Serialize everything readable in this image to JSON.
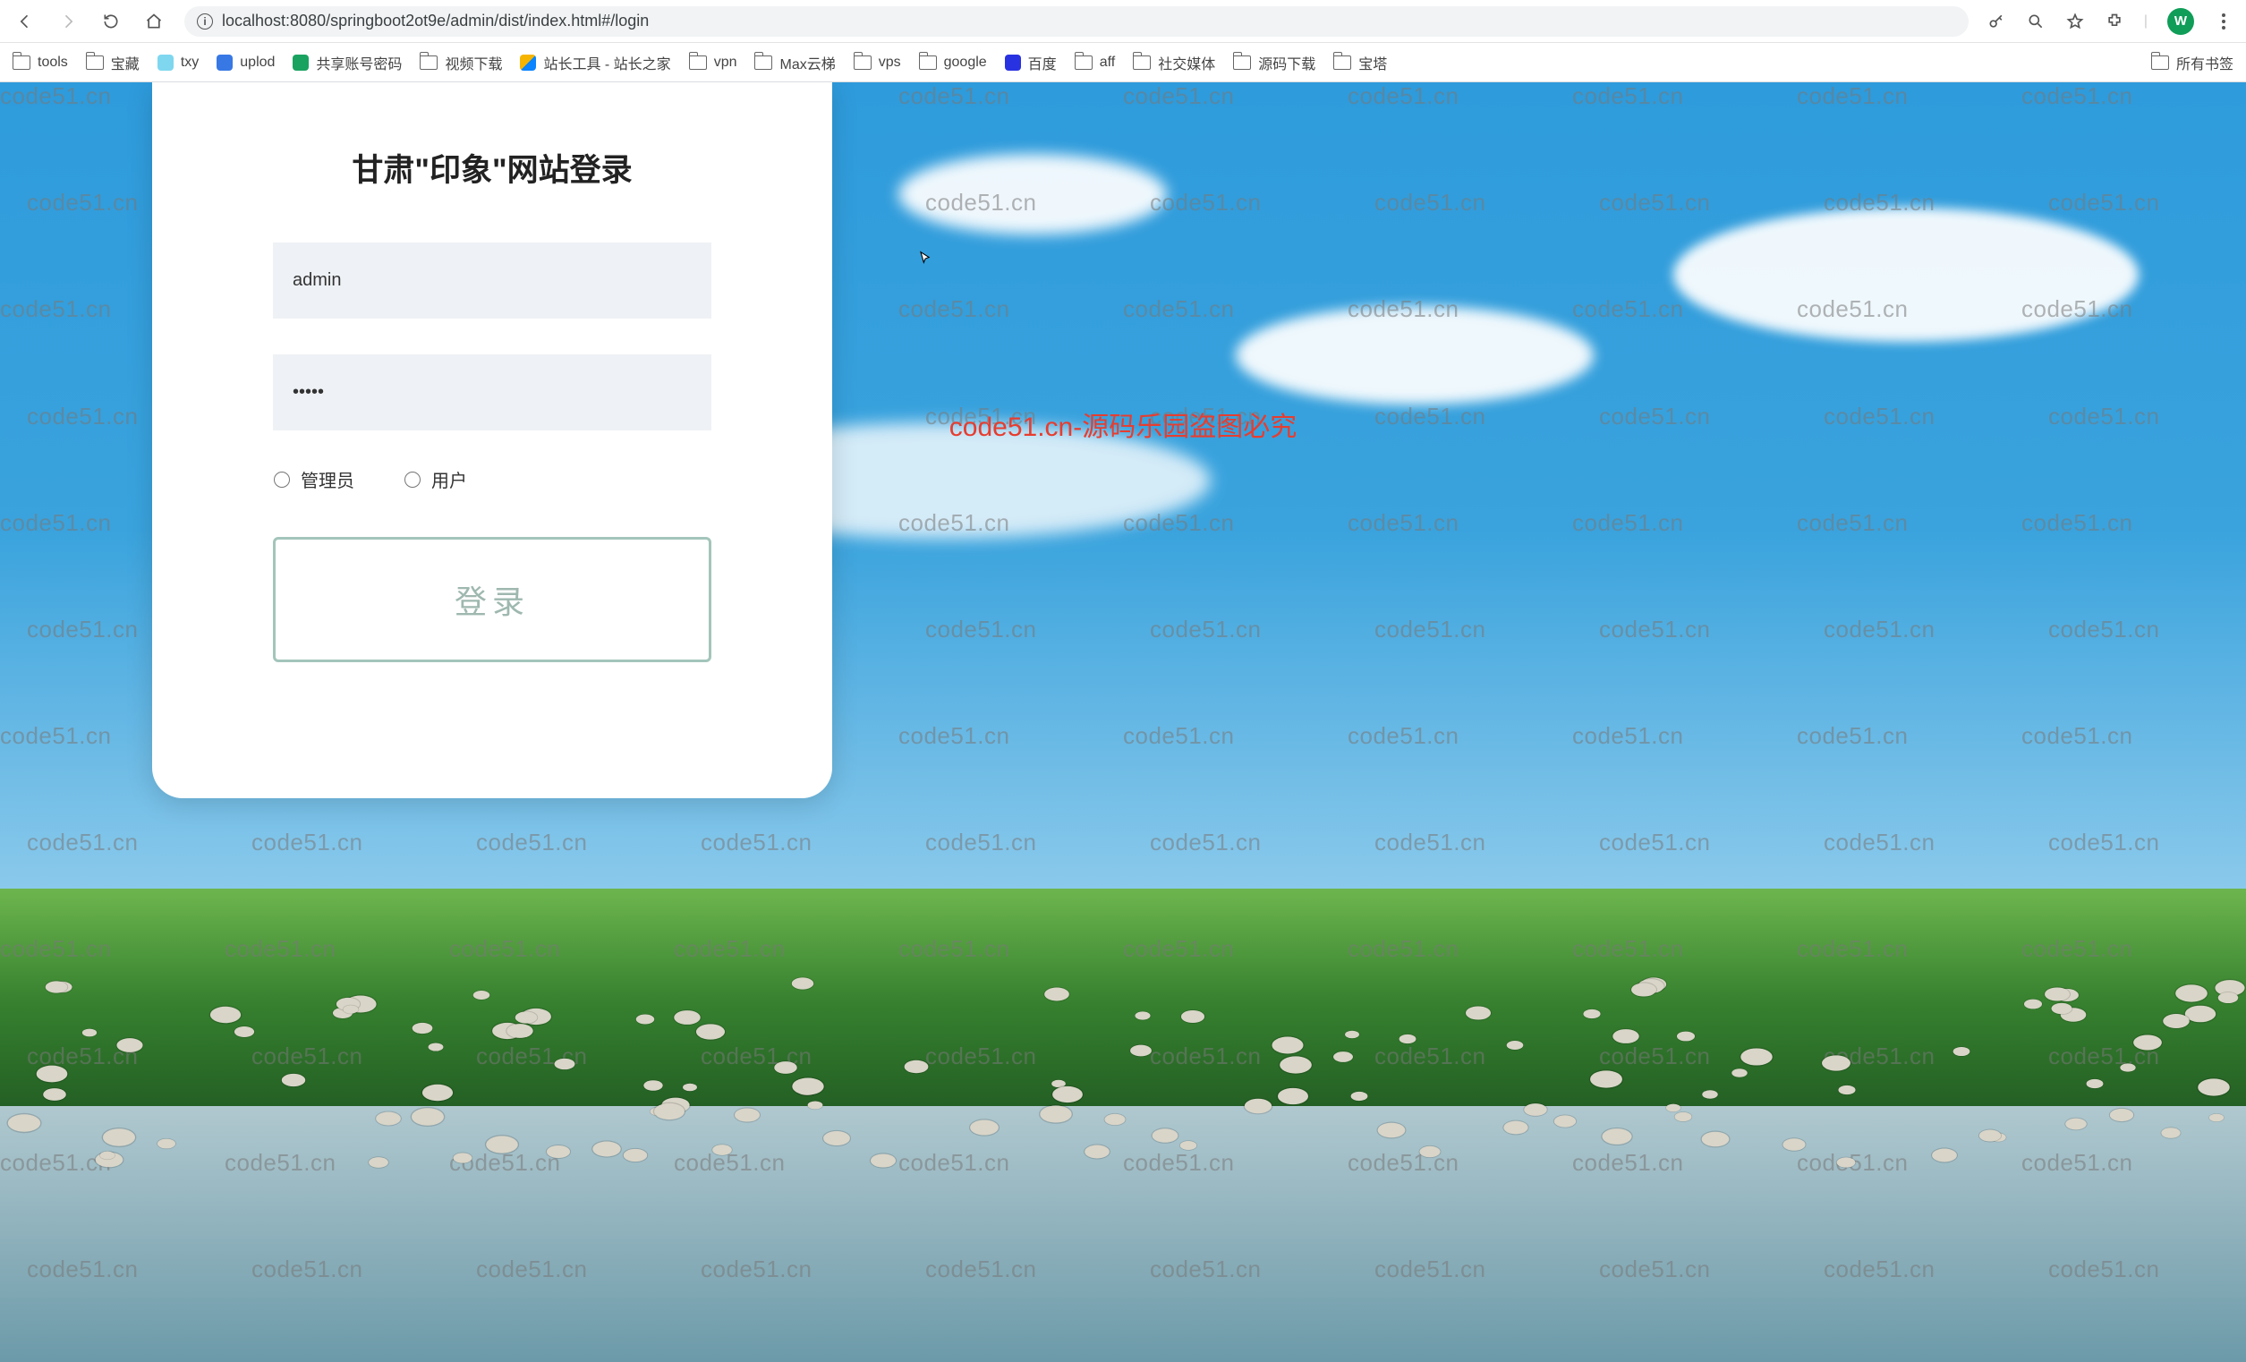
{
  "browser": {
    "url": "localhost:8080/springboot2ot9e/admin/dist/index.html#/login",
    "avatar_letter": "W"
  },
  "bookmarks": {
    "items": [
      {
        "label": "tools",
        "icon": "folder"
      },
      {
        "label": "宝藏",
        "icon": "folder"
      },
      {
        "label": "txy",
        "icon": "cloud"
      },
      {
        "label": "uplod",
        "icon": "blue"
      },
      {
        "label": "共享账号密码",
        "icon": "sheet"
      },
      {
        "label": "视频下载",
        "icon": "folder"
      },
      {
        "label": "站长工具 - 站长之家",
        "icon": "tool"
      },
      {
        "label": "vpn",
        "icon": "folder"
      },
      {
        "label": "Max云梯",
        "icon": "folder"
      },
      {
        "label": "vps",
        "icon": "folder"
      },
      {
        "label": "google",
        "icon": "folder"
      },
      {
        "label": "百度",
        "icon": "baidu"
      },
      {
        "label": "aff",
        "icon": "folder"
      },
      {
        "label": "社交媒体",
        "icon": "folder"
      },
      {
        "label": "源码下载",
        "icon": "folder"
      },
      {
        "label": "宝塔",
        "icon": "folder"
      }
    ],
    "overflow_label": "所有书签"
  },
  "login": {
    "title": "甘肃\"印象\"网站登录",
    "username_value": "admin",
    "password_value": "•••••",
    "role_admin": "管理员",
    "role_user": "用户",
    "submit_label": "登录"
  },
  "watermark": {
    "text": "code51.cn",
    "overlay": "code51.cn-源码乐园盗图必究"
  }
}
